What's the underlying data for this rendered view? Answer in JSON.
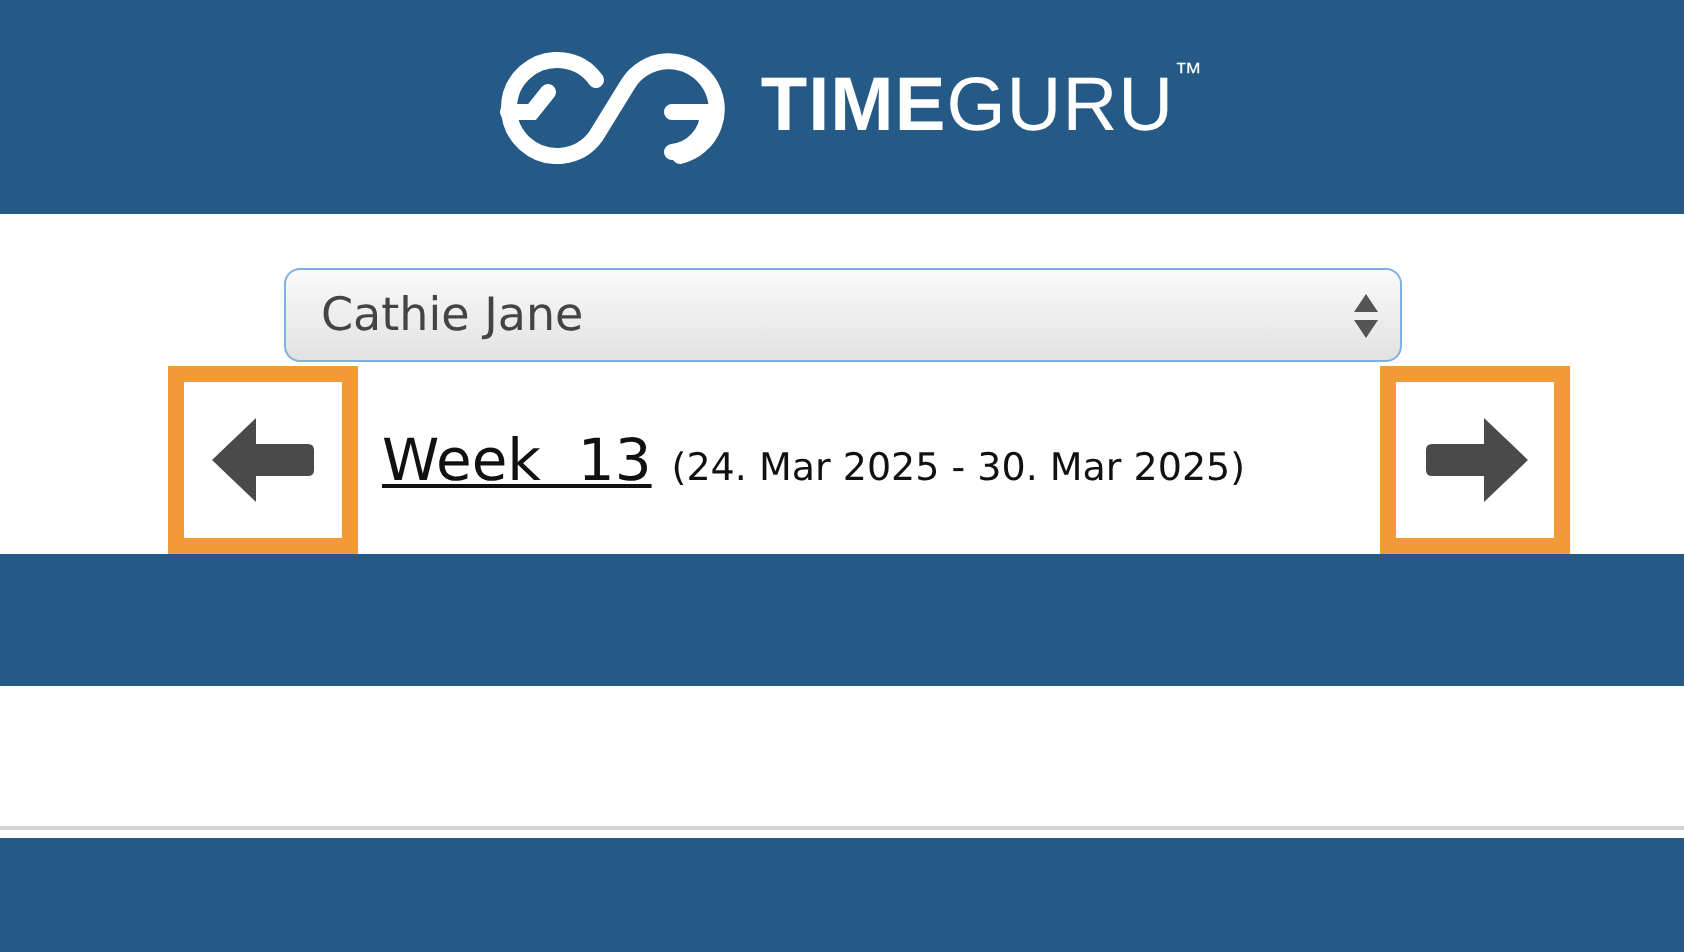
{
  "header": {
    "logo": "**TIME**GURU$^{™}$"
  },
  "employee_select": {
    "value": "Cathie Jane"
  },
  "week_nav": {
    "prev_button": {
      "highlighted": true
    },
    "week_label": "Week  13",
    "date_range": "(24. Mar 2025 - 30. Mar 2025)",
    "next_button": {
      "highlighted": true
    }
  }
}
